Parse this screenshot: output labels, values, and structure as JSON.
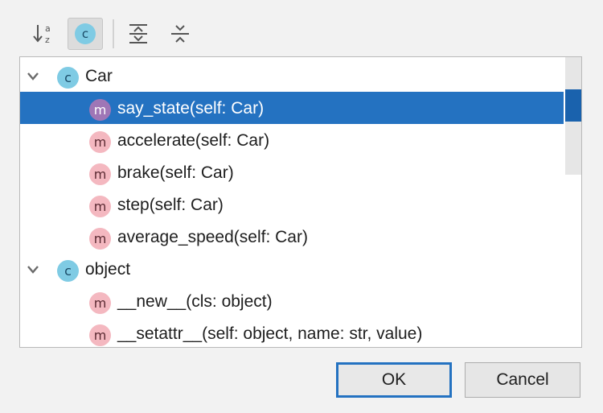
{
  "toolbar": {
    "sort_alpha_icon": "sort-alphabetically-icon",
    "show_classes_icon": "class-icon",
    "show_classes_label": "c",
    "expand_all_icon": "expand-all-icon",
    "collapse_all_icon": "collapse-all-icon"
  },
  "tree": {
    "groups": [
      {
        "label": "Car",
        "badge": "c",
        "expanded": true,
        "methods": [
          {
            "label": "say_state(self: Car)",
            "badge": "m",
            "selected": true
          },
          {
            "label": "accelerate(self: Car)",
            "badge": "m"
          },
          {
            "label": "brake(self: Car)",
            "badge": "m"
          },
          {
            "label": "step(self: Car)",
            "badge": "m"
          },
          {
            "label": "average_speed(self: Car)",
            "badge": "m"
          }
        ]
      },
      {
        "label": "object",
        "badge": "c",
        "expanded": true,
        "methods": [
          {
            "label": "__new__(cls: object)",
            "badge": "m"
          },
          {
            "label": "__setattr__(self: object, name: str, value)",
            "badge": "m"
          }
        ]
      }
    ]
  },
  "buttons": {
    "ok": "OK",
    "cancel": "Cancel"
  },
  "colors": {
    "selection": "#2472c1",
    "class_badge": "#7fcbe4",
    "method_badge": "#f4b8c0",
    "method_badge_selected": "#9f76b6"
  }
}
